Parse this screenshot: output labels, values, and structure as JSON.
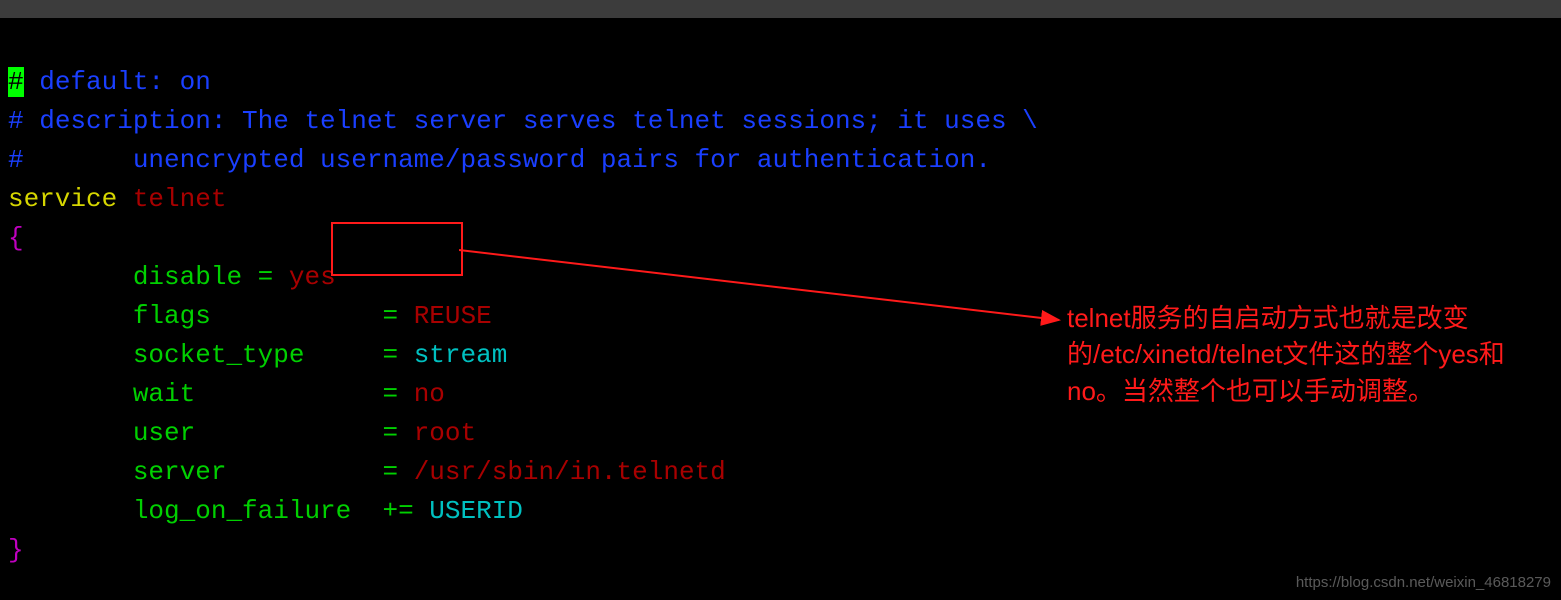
{
  "comments": {
    "line1_hash": "#",
    "line1_rest": " default: on",
    "line2_hash": "#",
    "line2_rest": " description: The telnet server serves telnet sessions; it uses \\",
    "line3_hash": "#",
    "line3_rest": "       unencrypted username/password pairs for authentication."
  },
  "service": {
    "keyword": "service",
    "name": "telnet",
    "open_brace": "{",
    "close_brace": "}"
  },
  "config": {
    "disable": {
      "key": "disable",
      "pad": " ",
      "op": "= ",
      "val": "yes",
      "val_class": "val-red"
    },
    "flags": {
      "key": "flags",
      "pad": "           ",
      "op": "= ",
      "val": "REUSE",
      "val_class": "val-red"
    },
    "socket_type": {
      "key": "socket_type",
      "pad": "     ",
      "op": "= ",
      "val": "stream",
      "val_class": "val-cyan"
    },
    "wait": {
      "key": "wait",
      "pad": "            ",
      "op": "= ",
      "val": "no",
      "val_class": "val-red"
    },
    "user": {
      "key": "user",
      "pad": "            ",
      "op": "= ",
      "val": "root",
      "val_class": "val-red"
    },
    "server": {
      "key": "server",
      "pad": "          ",
      "op": "= ",
      "val": "/usr/sbin/in.telnetd",
      "val_class": "val-red"
    },
    "log_on_failure": {
      "key": "log_on_failure",
      "pad": "  ",
      "op": "+= ",
      "val": "USERID",
      "val_class": "val-cyan"
    }
  },
  "annotation": {
    "text": "telnet服务的自启动方式也就是改变的/etc/xinetd/telnet文件这的整个yes和no。当然整个也可以手动调整。"
  },
  "watermark": "https://blog.csdn.net/weixin_46818279"
}
